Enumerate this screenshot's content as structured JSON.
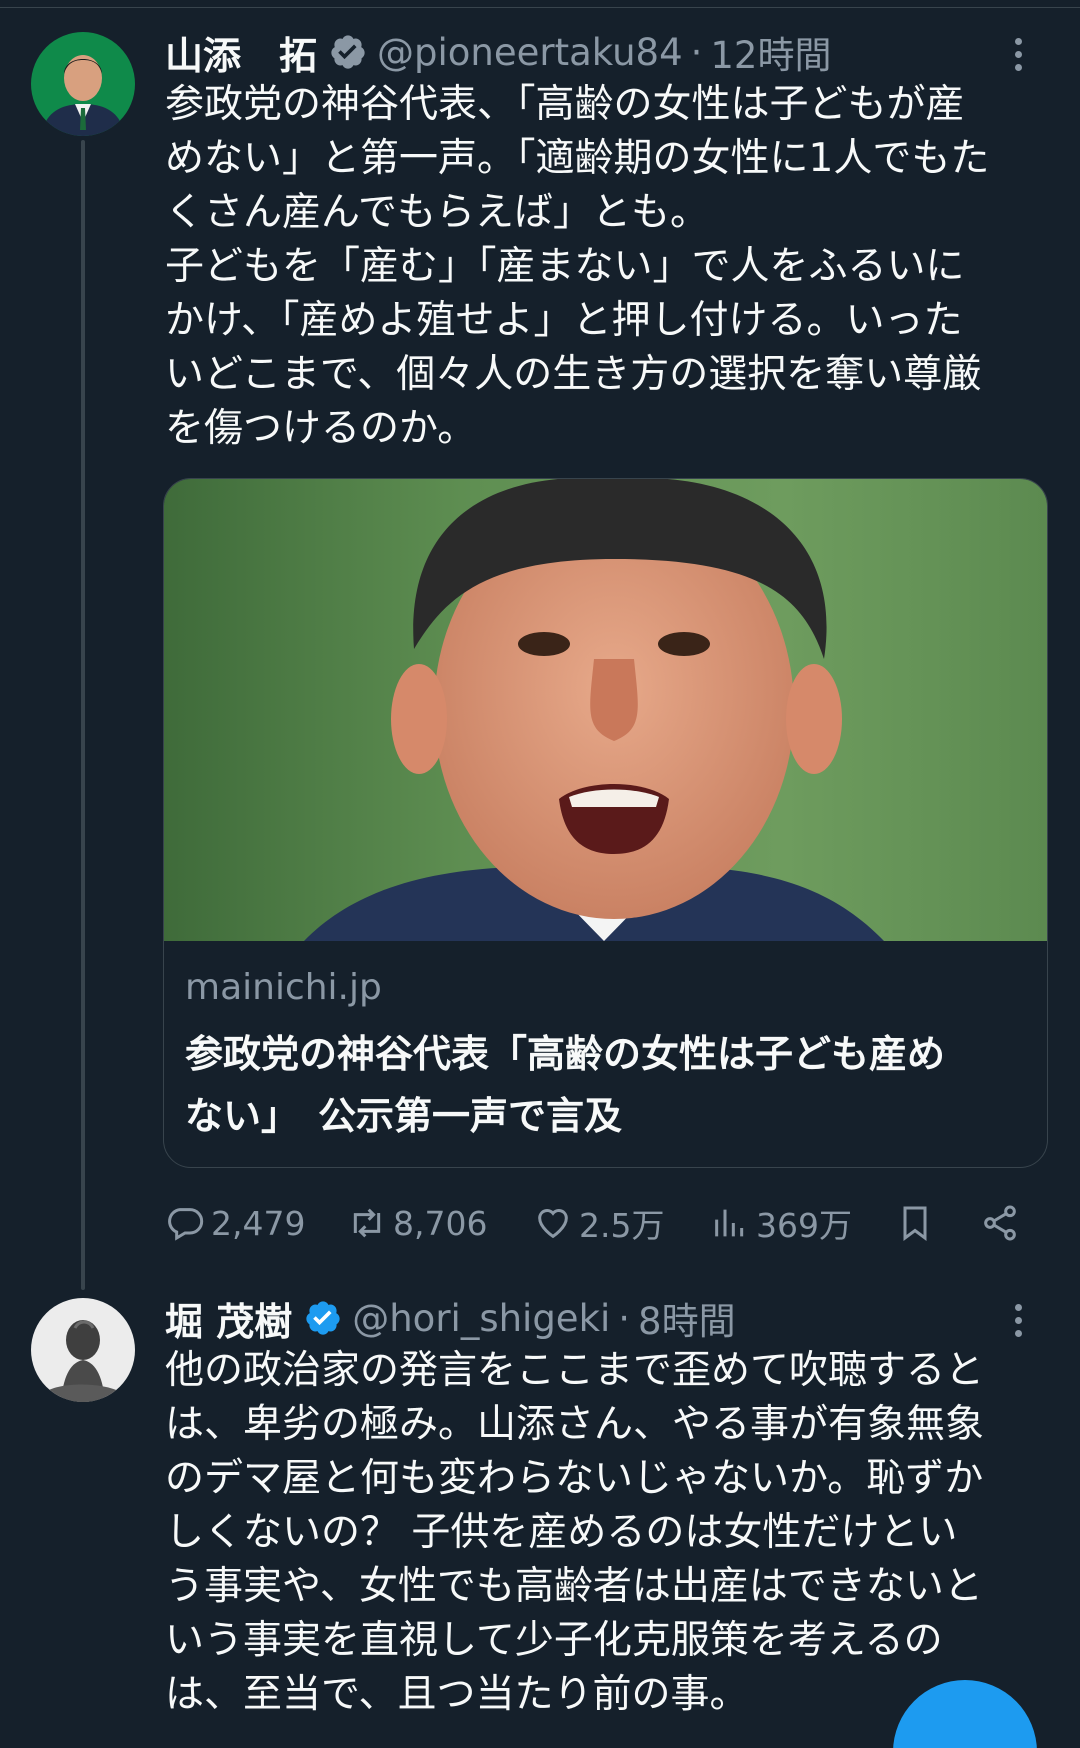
{
  "colors": {
    "background": "#15202b",
    "text": "#f7f9f9",
    "secondary": "#8b98a5",
    "border": "#38444d",
    "accent": "#1d9bf0"
  },
  "tweet1": {
    "name": "山添　拓",
    "handle": "@pioneertaku84",
    "dot": "·",
    "time": "12時間",
    "text": "参政党の神谷代表、「高齢の女性は子どもが産\nめない」と第一声。「適齢期の女性に1人でもた\nくさん産んでもらえば」とも。\n子どもを「産む」「産まない」で人をふるいに\nかけ、「産めよ殖せよ」と押し付ける。いった\nいどこまで、個々人の生き方の選択を奪い尊厳\nを傷つけるのか。",
    "card": {
      "domain": "mainichi.jp",
      "title": "参政党の神谷代表「高齢の女性は子ども産め\nない」　公示第一声で言及"
    },
    "actions": {
      "reply": "2,479",
      "retweet": "8,706",
      "like": "2.5万",
      "views": "369万"
    }
  },
  "tweet2": {
    "name": "堀 茂樹",
    "handle": "@hori_shigeki",
    "dot": "·",
    "time": "8時間",
    "text": "他の政治家の発言をここまで歪めて吹聴すると\nは、卑劣の極み。山添さん、やる事が有象無象\nのデマ屋と何も変わらないじゃないか。恥ずか\nしくないの？ 子供を産めるのは女性だけとい\nう事実や、女性でも高齢者は出産はできないと\nいう事実を直視して少子化克服策を考えるの\nは、至当で、且つ当たり前の事。"
  }
}
